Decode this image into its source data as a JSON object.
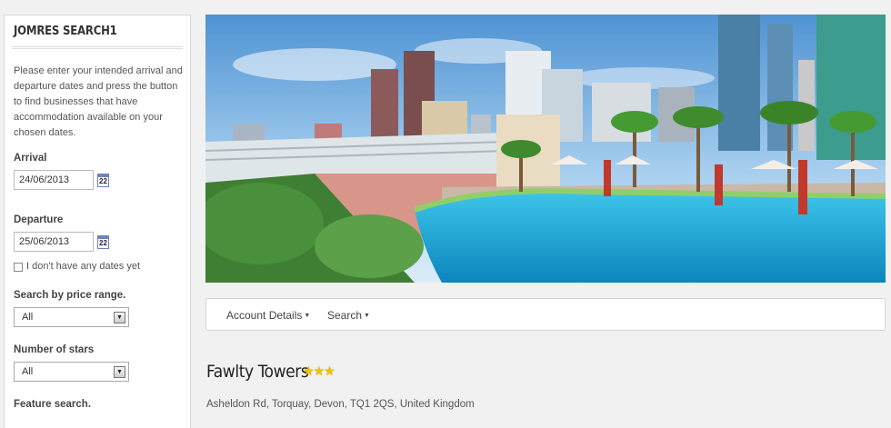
{
  "sidebar": {
    "title": "JOMRES SEARCH1",
    "intro": "Please enter your intended arrival and departure dates and press the button to find businesses that have accommodation available on your chosen dates.",
    "arrival_label": "Arrival",
    "arrival_value": "24/06/2013",
    "departure_label": "Departure",
    "departure_value": "25/06/2013",
    "calendar_icon_text": "22",
    "no_dates_label": "I don't have any dates yet",
    "price_label": "Search by price range.",
    "price_selected": "All",
    "stars_label": "Number of stars",
    "stars_selected": "All",
    "feature_label": "Feature search."
  },
  "nav": {
    "items": [
      {
        "label": "Account Details"
      },
      {
        "label": "Search"
      }
    ]
  },
  "property": {
    "name": "Fawlty Towers",
    "stars": 3,
    "address": "Asheldon Rd, Torquay, Devon, TQ1 2QS, United Kingdom"
  },
  "colors": {
    "pool": "#19a9d8",
    "sky": "#7fb5e0",
    "star": "#f2c200"
  },
  "icons": {
    "calendar": "calendar-icon",
    "dropdown": "chevron-down-icon",
    "star": "star-icon"
  }
}
